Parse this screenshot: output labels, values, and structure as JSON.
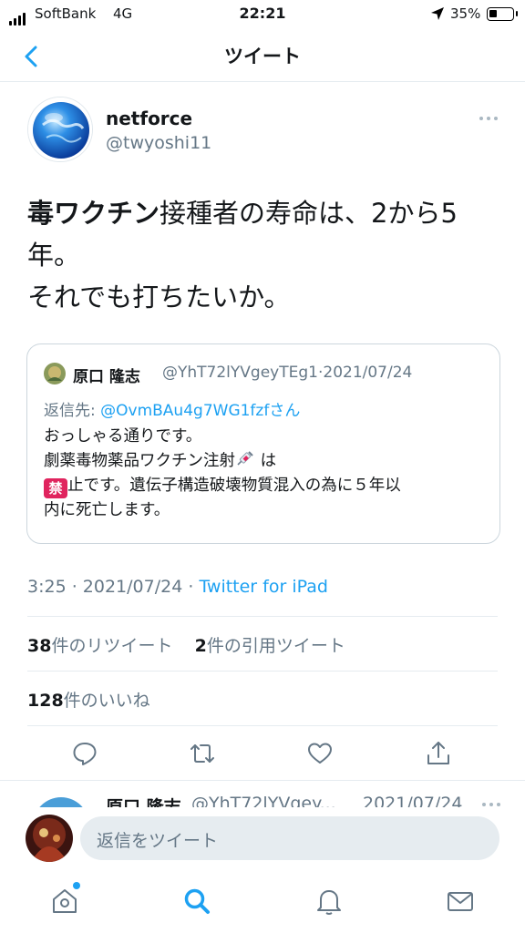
{
  "status_bar": {
    "carrier": "SoftBank",
    "network": "4G",
    "time": "22:21",
    "battery": "35%",
    "battery_level": 0.35
  },
  "header": {
    "title": "ツイート"
  },
  "tweet": {
    "name": "netforce",
    "handle": "@twyoshi11",
    "text_bold": "毒ワクチン",
    "text_line1_rest": "接種者の寿命は、2から5",
    "text_line2": "年。",
    "text_line3": "それでも打ちたいか。",
    "time": "3:25",
    "date": "2021/07/24",
    "via": "Twitter for iPad",
    "retweets_count": "38",
    "retweets_label": "件のリツイート",
    "quotes_count": "2",
    "quotes_label": "件の引用ツイート",
    "likes_count": "128",
    "likes_label": "件のいいね"
  },
  "quoted_tweet": {
    "name": "原口 隆志",
    "handle": "@YhT72lYVgeyTEg1",
    "date": "2021/07/24",
    "reply_prefix": "返信先: ",
    "reply_handle": "@OvmBAu4g7WG1fzf",
    "reply_suffix": "さん",
    "line1": "おっしゃる通りです。",
    "line2_a": "劇薬毒物薬品ワクチン注射",
    "line2_b": " は",
    "ban_glyph": "禁",
    "line3": "止です。遺伝子構造破壊物質混入の為に５年以",
    "line4": "内に死亡します。"
  },
  "next_reply": {
    "name": "原口 隆志",
    "handle": "@YhT72lYVgey...",
    "date": "2021/07/24"
  },
  "compose": {
    "placeholder": "返信をツイート"
  },
  "icons": {
    "back": "chevron-left-icon",
    "reply": "reply-icon",
    "retweet": "retweet-icon",
    "like": "heart-icon",
    "share": "share-icon",
    "home": "home-icon",
    "search": "search-icon",
    "notifications": "bell-icon",
    "messages": "mail-icon"
  },
  "colors": {
    "accent": "#1da1f2",
    "secondary_text": "#657786",
    "ban": "#e0245e"
  }
}
